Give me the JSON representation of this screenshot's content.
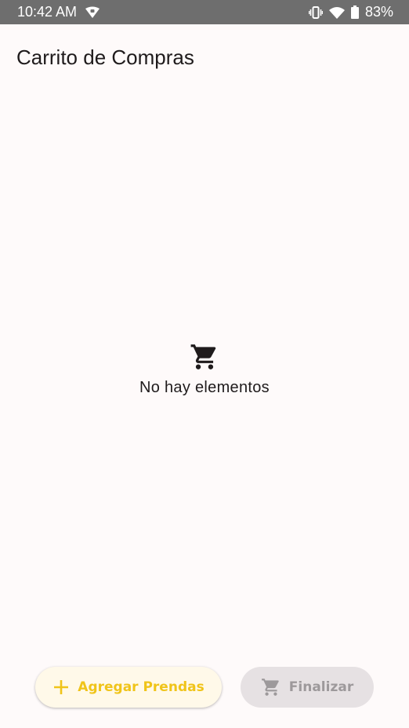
{
  "status_bar": {
    "time": "10:42 AM",
    "battery": "83%",
    "icons": [
      "vpn-shield-icon",
      "vibrate-icon",
      "wifi-icon",
      "battery-icon"
    ]
  },
  "app": {
    "title": "Carrito de Compras"
  },
  "empty_state": {
    "icon": "shopping-cart-icon",
    "text": "No hay elementos"
  },
  "actions": {
    "add_label": "Agregar Prendas",
    "add_icon": "plus-icon",
    "finish_label": "Finalizar",
    "finish_icon": "shopping-cart-icon",
    "finish_enabled": false
  },
  "colors": {
    "status_bar": "#6e6e6e",
    "background": "#fefafa",
    "accent": "#f0c419",
    "add_button_bg": "#fff9e9",
    "disabled_bg": "#e6e1e3",
    "disabled_text": "#9d999b"
  }
}
